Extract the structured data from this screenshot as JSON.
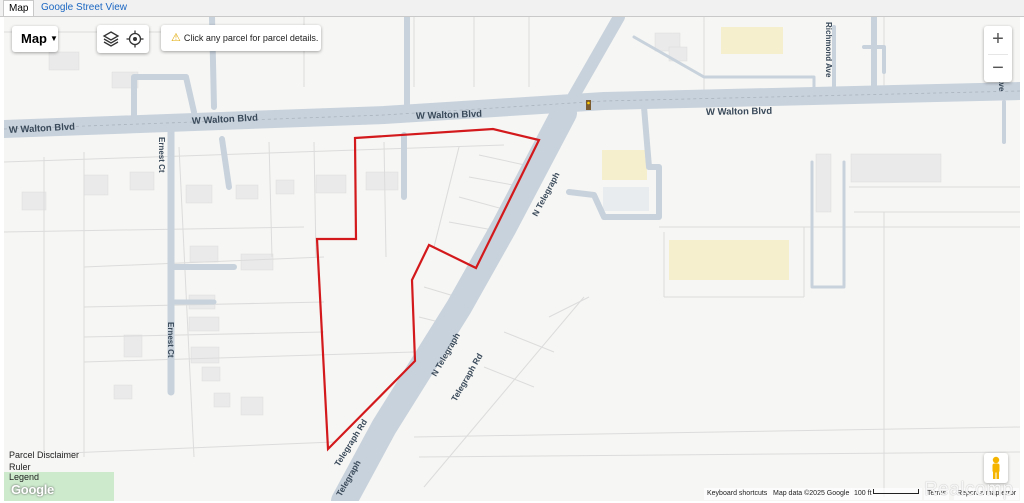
{
  "tabs": [
    {
      "label": "Map",
      "active": true
    },
    {
      "label": "Google Street View",
      "active": false
    }
  ],
  "map": {
    "map_type_label": "Map",
    "hint": "Click any parcel for parcel details.",
    "zoom_in": "+",
    "zoom_out": "−",
    "road_labels": {
      "walton_1": "W Walton Blvd",
      "walton_2": "W Walton Blvd",
      "walton_3": "W Walton Blvd",
      "walton_4": "W Walton Blvd",
      "ernest_1": "Ernest Ct",
      "ernest_2": "Ernest Ct",
      "telegraph_1": "N Telegraph",
      "telegraph_2": "N Telegraph",
      "telegraph_3": "Telegraph Rd",
      "telegraph_4": "Telegraph Rd",
      "telegraph_5": "Telegraph",
      "richmond": "Richmond Ave",
      "ave": "Ave"
    },
    "parcel_outline_color": "#d3191c",
    "road_color": "#c8d2dc",
    "highlight_color": "#f6efce",
    "park_color": "#cdeacd"
  },
  "overlays": {
    "parcel_disclaimer": "Parcel Disclaimer",
    "ruler": "Ruler",
    "legend": "Legend",
    "google_logo": "Google",
    "keyboard_shortcuts": "Keyboard shortcuts",
    "map_data": "Map data ©2025 Google",
    "scale": "100 ft",
    "terms": "Terms",
    "report": "Report a map error",
    "watermark": "Realcomp"
  },
  "icons": {
    "layers": "layers-icon",
    "locate": "crosshair-icon",
    "warning": "warning-icon",
    "pegman": "pegman-icon"
  }
}
